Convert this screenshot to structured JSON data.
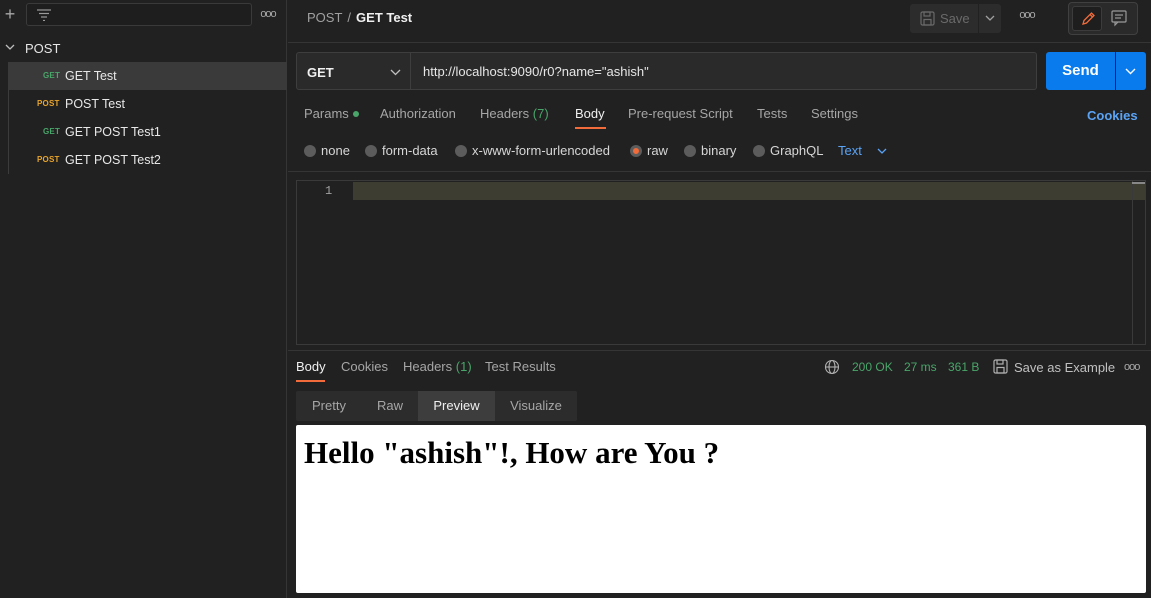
{
  "sidebar": {
    "collection_name": "POST",
    "items": [
      {
        "method": "GET",
        "method_class": "get",
        "label": "GET Test",
        "active": true
      },
      {
        "method": "POST",
        "method_class": "post",
        "label": "POST Test",
        "active": false
      },
      {
        "method": "GET",
        "method_class": "get",
        "label": "GET POST Test1",
        "active": false
      },
      {
        "method": "POST",
        "method_class": "post",
        "label": "GET POST Test2",
        "active": false
      }
    ],
    "more_label": "ooo"
  },
  "header": {
    "breadcrumb_parent": "POST",
    "breadcrumb_sep": "/",
    "breadcrumb_current": "GET Test",
    "save_label": "Save",
    "more_label": "ooo"
  },
  "request": {
    "method": "GET",
    "url": "http://localhost:9090/r0?name=\"ashish\"",
    "send_label": "Send",
    "tabs": {
      "params": "Params",
      "authorization": "Authorization",
      "headers": "Headers",
      "headers_count": "(7)",
      "body": "Body",
      "prerequest": "Pre-request Script",
      "tests": "Tests",
      "settings": "Settings"
    },
    "cookies_label": "Cookies",
    "body_types": {
      "none": "none",
      "form_data": "form-data",
      "urlencoded": "x-www-form-urlencoded",
      "raw": "raw",
      "binary": "binary",
      "graphql": "GraphQL"
    },
    "selected_body_type": "raw",
    "raw_format": "Text",
    "editor_line": "1"
  },
  "response": {
    "tabs": {
      "body": "Body",
      "cookies": "Cookies",
      "headers": "Headers",
      "headers_count": "(1)",
      "test_results": "Test Results"
    },
    "status": "200 OK",
    "time": "27 ms",
    "size": "361 B",
    "save_example_label": "Save as Example",
    "more_label": "ooo",
    "view_tabs": {
      "pretty": "Pretty",
      "raw": "Raw",
      "preview": "Preview",
      "visualize": "Visualize"
    },
    "active_view": "Preview",
    "preview_text": "Hello \"ashish\"!, How are You ?"
  },
  "colors": {
    "accent_orange": "#f26b3a",
    "send_blue": "#097bed",
    "link_blue": "#5aa3f5",
    "get_green": "#4aa56a",
    "post_orange": "#e8a52c"
  }
}
